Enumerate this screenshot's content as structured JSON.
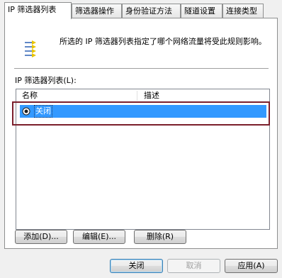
{
  "tabs": [
    {
      "label": "IP 筛选器列表",
      "active": true
    },
    {
      "label": "筛选器操作",
      "active": false
    },
    {
      "label": "身份验证方法",
      "active": false
    },
    {
      "label": "隧道设置",
      "active": false
    },
    {
      "label": "连接类型",
      "active": false
    }
  ],
  "icon": {
    "name": "ip-filter-list-icon"
  },
  "description": "所选的 IP 筛选器列表指定了哪个网络流量将受此规则影响。",
  "list": {
    "label": "IP 筛选器列表(L):",
    "columns": [
      "名称",
      "描述"
    ],
    "rows": [
      {
        "name": "关闭",
        "description": "",
        "selected": true
      }
    ]
  },
  "list_buttons": {
    "add": "添加(D)...",
    "edit": "编辑(E)...",
    "delete": "删除(R)"
  },
  "dialog_buttons": {
    "close": "关闭",
    "cancel": "取消",
    "apply": "应用(A)"
  },
  "colors": {
    "selection": "#3399ff",
    "annotation_box": "#7b1f2b"
  }
}
